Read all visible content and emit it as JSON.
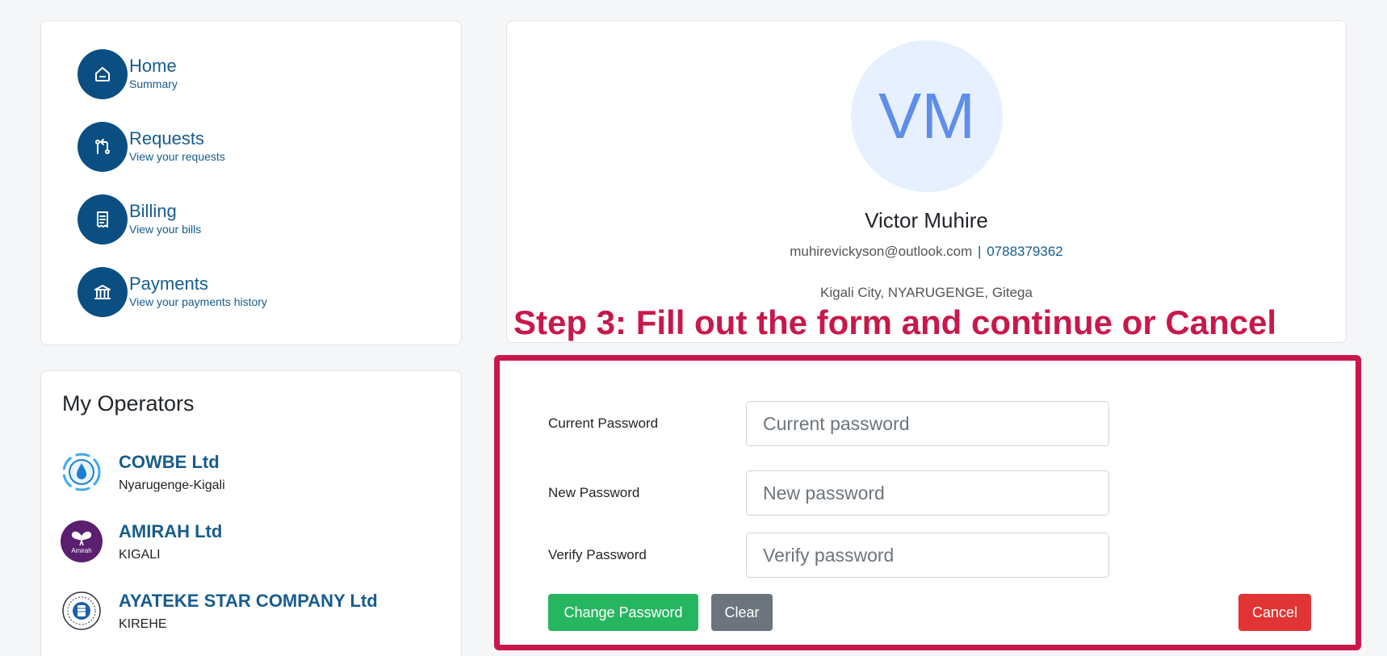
{
  "nav": {
    "items": [
      {
        "title": "Home",
        "subtitle": "Summary",
        "icon": "home-icon"
      },
      {
        "title": "Requests",
        "subtitle": "View your requests",
        "icon": "git-pull-request-icon"
      },
      {
        "title": "Billing",
        "subtitle": "View your bills",
        "icon": "receipt-icon"
      },
      {
        "title": "Payments",
        "subtitle": "View your payments history",
        "icon": "bank-icon"
      }
    ]
  },
  "operators": {
    "title": "My Operators",
    "items": [
      {
        "name": "COWBE Ltd",
        "location": "Nyarugenge-Kigali",
        "logo_text": ""
      },
      {
        "name": "AMIRAH Ltd",
        "location": "KIGALI",
        "logo_text": "Amirah"
      },
      {
        "name": "AYATEKE STAR COMPANY Ltd",
        "location": "KIREHE",
        "logo_text": ""
      }
    ]
  },
  "profile": {
    "initials": "VM",
    "name": "Victor Muhire",
    "email": "muhirevickyson@outlook.com",
    "separator": "|",
    "phone": "0788379362",
    "address": "Kigali City, NYARUGENGE, Gitega"
  },
  "annotation": {
    "step_title": "Step 3: Fill out the form and continue or Cancel",
    "color": "#c8184a"
  },
  "form": {
    "current": {
      "label": "Current Password",
      "placeholder": "Current password",
      "value": ""
    },
    "new": {
      "label": "New Password",
      "placeholder": "New password",
      "value": ""
    },
    "verify": {
      "label": "Verify Password",
      "placeholder": "Verify password",
      "value": ""
    },
    "change_label": "Change Password",
    "clear_label": "Clear",
    "cancel_label": "Cancel"
  },
  "colors": {
    "primary": "#0b4f82",
    "link": "#175c8d",
    "success": "#27b660",
    "secondary": "#6c757d",
    "danger": "#e13434",
    "avatar_bg": "#e7f0fe",
    "avatar_text": "#5f8ee9"
  }
}
